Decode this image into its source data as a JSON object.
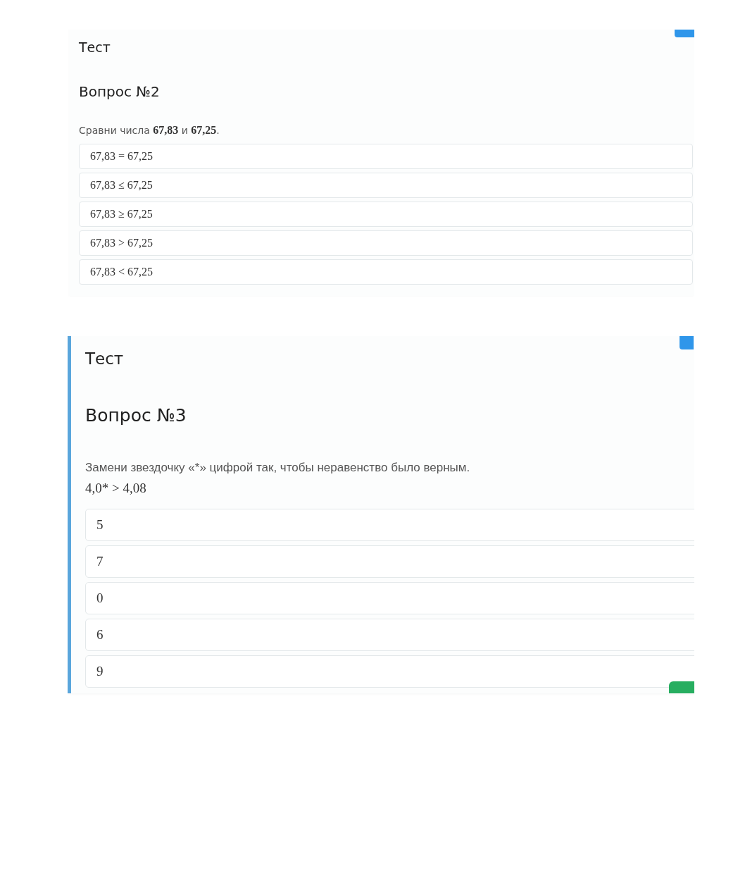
{
  "cards": [
    {
      "header": "Тест",
      "question": "Вопрос №2",
      "prompt": "Сравни числа **67,83** и **67,25**.",
      "active": false,
      "options": [
        "67,83 = 67,25",
        "67,83 ≤ 67,25",
        "67,83 ≥ 67,25",
        "67,83 > 67,25",
        "67,83 < 67,25"
      ]
    },
    {
      "header": "Тест",
      "question": "Вопрос №3",
      "prompt": "Замени звездочку «*» цифрой так, чтобы неравенство было верным.",
      "formula": "4,0* > 4,08",
      "active": true,
      "options": [
        "5",
        "7",
        "0",
        "6",
        "9"
      ]
    }
  ]
}
